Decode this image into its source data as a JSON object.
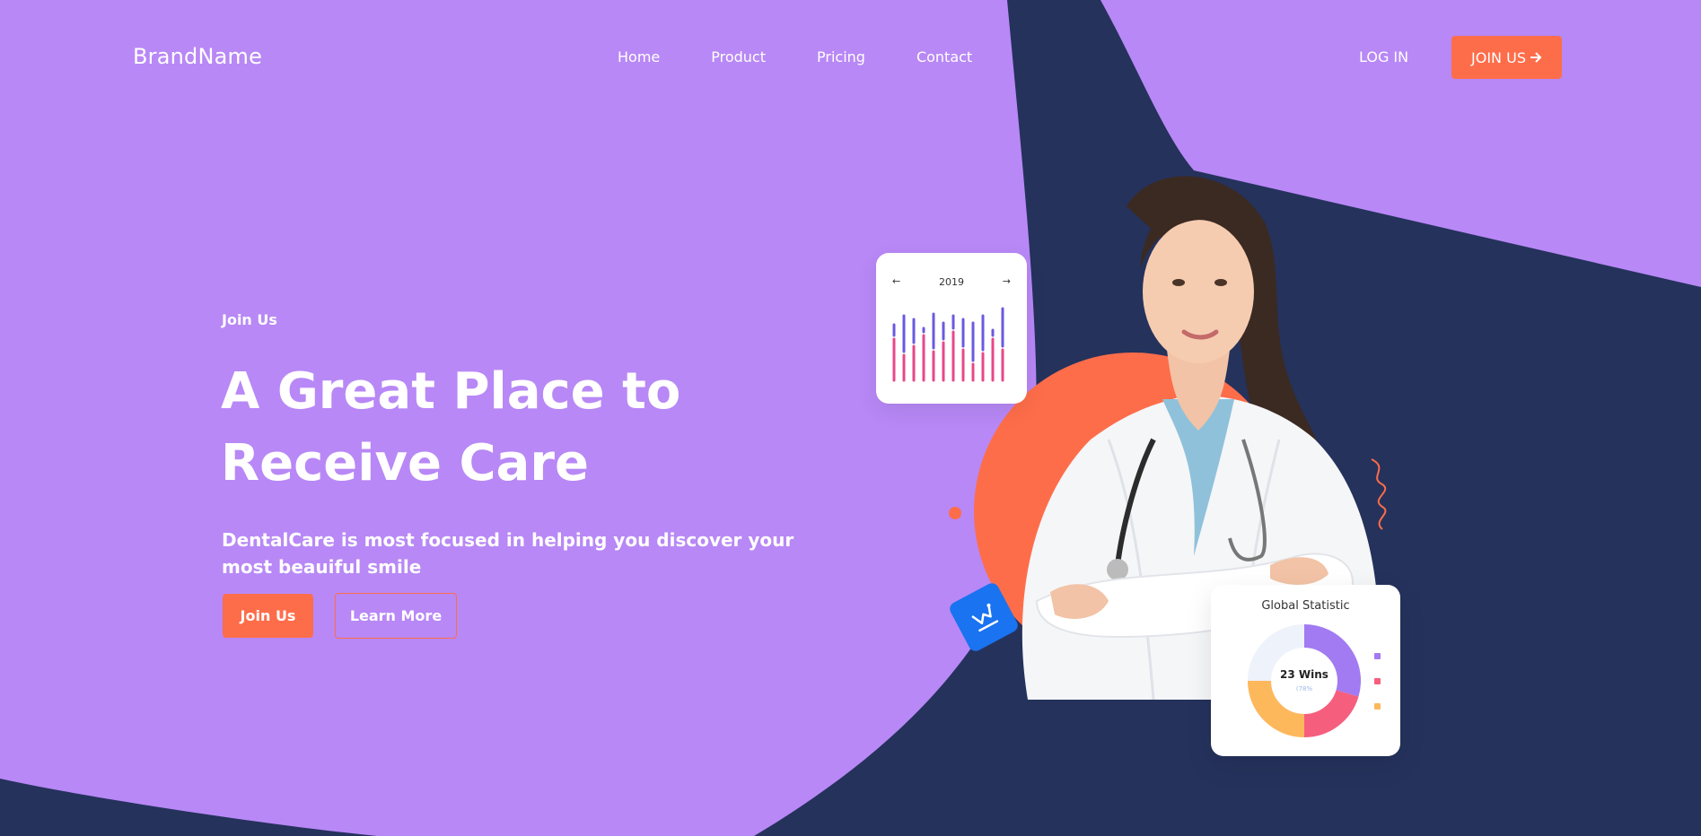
{
  "header": {
    "brand": "BrandName",
    "nav": [
      "Home",
      "Product",
      "Pricing",
      "Contact"
    ],
    "login": "LOG IN",
    "join_label": "JOIN US",
    "join_icon": "arrow-right-icon"
  },
  "hero": {
    "eyebrow": "Join Us",
    "headline": "A Great Place to Receive Care",
    "subtext": "DentalCare is most focused in helping you discover your most beauiful smile",
    "primary_button": "Join Us",
    "secondary_button": "Learn More"
  },
  "chart_card": {
    "year": "2019",
    "prev_icon": "arrow-left-icon",
    "next_icon": "arrow-right-icon"
  },
  "stat_card": {
    "title": "Global Statistic",
    "center_label": "23 Wins",
    "center_sub": "(78%"
  },
  "colors": {
    "background": "#b888f6",
    "navy": "#25325c",
    "accent": "#fe6d4a",
    "badge": "#1a73f0"
  }
}
